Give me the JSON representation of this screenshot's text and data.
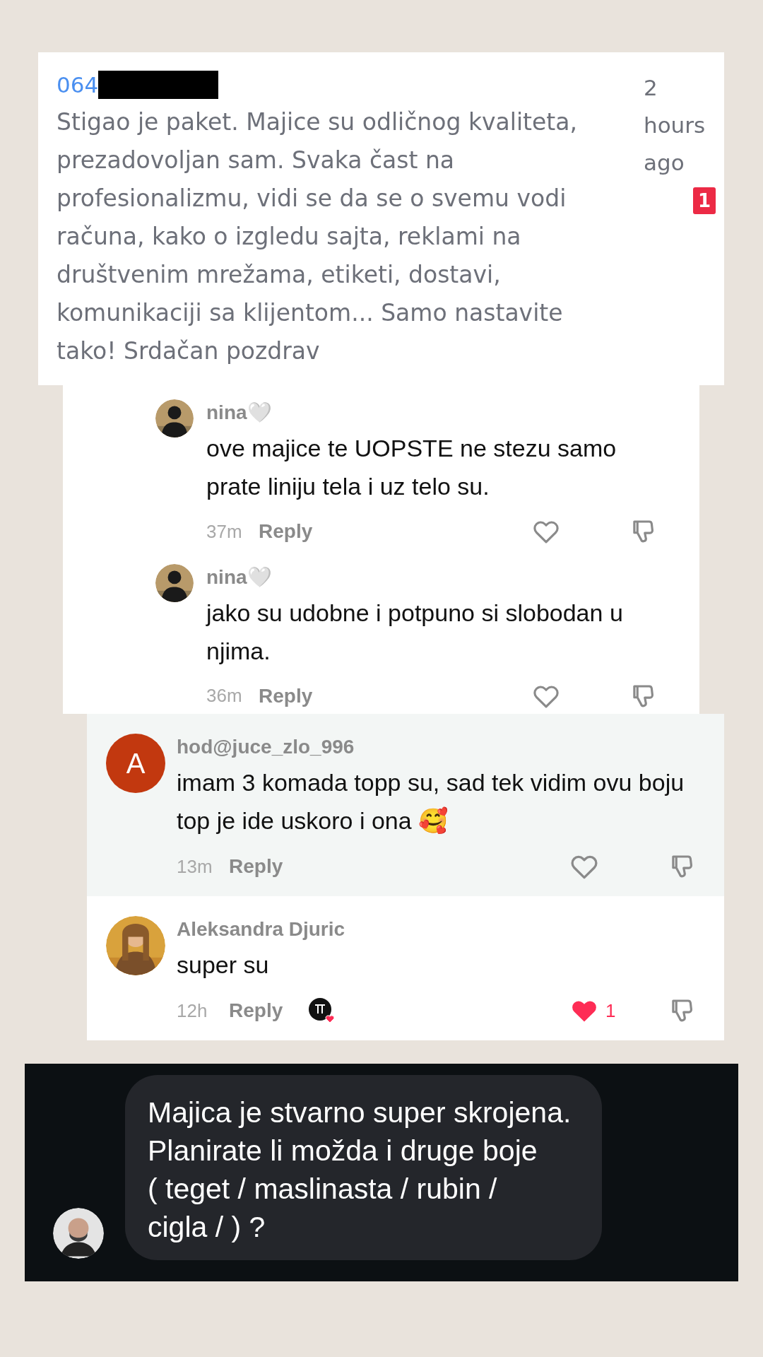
{
  "review": {
    "phone": "064",
    "redacted": true,
    "text": "Stigao je paket. Majice su odličnog kvaliteta, prezadovoljan sam. Svaka čast na profesionalizmu, vidi se da se o svemu vodi računa, kako o izgledu sajta, reklami na društvenim mrežama, etiketi, dostavi, komunikaciji sa klijentom... Samo nastavite tako! Srdačan pozdrav",
    "time": "2 hours ago",
    "badge": "1"
  },
  "threads": [
    {
      "comments": [
        {
          "username": "nina🤍",
          "text": "ove majice te UOPSTE ne stezu samo prate liniju tela i uz telo su.",
          "time": "37m",
          "reply": "Reply",
          "liked": false
        },
        {
          "username": "nina🤍",
          "text": "jako su udobne i potpuno si slobodan u njima.",
          "time": "36m",
          "reply": "Reply",
          "liked": false
        }
      ]
    },
    {
      "comments": [
        {
          "avatar": {
            "kind": "letter",
            "letter": "A",
            "color": "#c2380f"
          },
          "username": "hod@juce_zlo_996",
          "text": "imam 3 komada topp su, sad tek vidim ovu boju top je ide uskoro i ona 🥰",
          "time": "13m",
          "reply": "Reply",
          "liked": false,
          "highlighted": true
        },
        {
          "username": "Aleksandra Djuric",
          "text": "super su",
          "time": "12h",
          "reply": "Reply",
          "liked": true,
          "like_count": "1",
          "creator_liked": true,
          "highlighted": false
        }
      ]
    }
  ],
  "message": {
    "lines": [
      "Majica je stvarno super skrojena.",
      "Planirate li možda i druge boje",
      "( teget / maslinasta / rubin /",
      "cigla / ) ?"
    ]
  }
}
